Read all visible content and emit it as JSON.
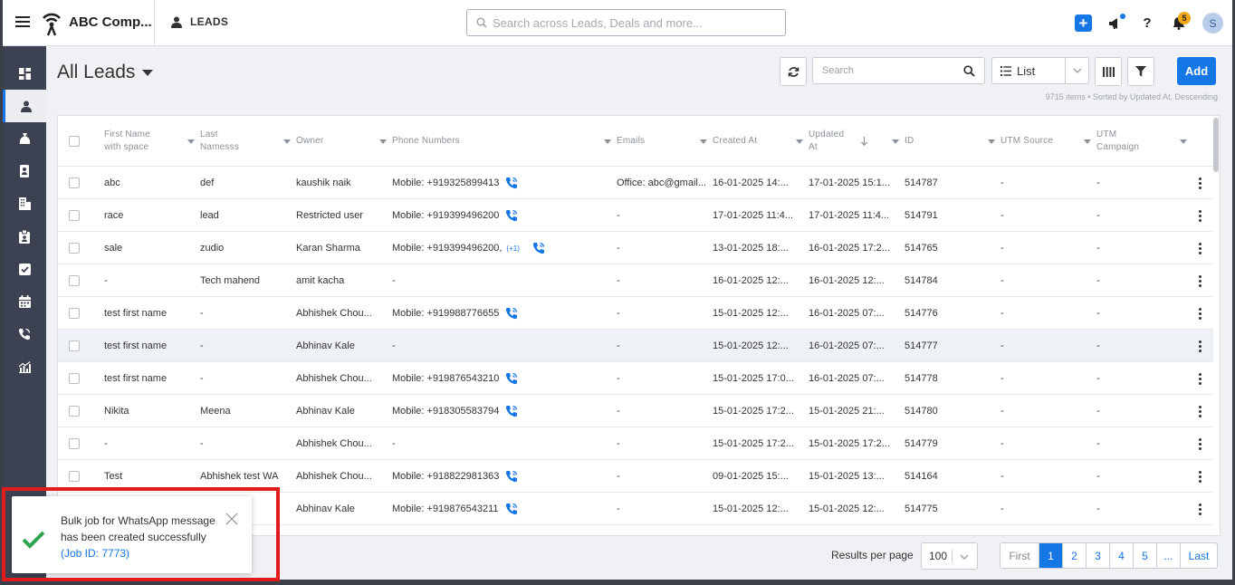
{
  "header": {
    "brand": "ABC Comp...",
    "module": "LEADS",
    "search_placeholder": "Search across Leads, Deals and more...",
    "notif_count": "5",
    "help": "?",
    "avatar": "S"
  },
  "sidebar": {
    "items": [
      {
        "icon": "dashboard-icon"
      },
      {
        "icon": "person-icon",
        "active": true
      },
      {
        "icon": "money-bag-icon"
      },
      {
        "icon": "contact-card-icon"
      },
      {
        "icon": "building-icon"
      },
      {
        "icon": "clipboard-icon"
      },
      {
        "icon": "checkbox-icon"
      },
      {
        "icon": "calendar-icon"
      },
      {
        "icon": "phone-icon"
      },
      {
        "icon": "analytics-icon"
      }
    ]
  },
  "toolbar": {
    "title": "All Leads",
    "search_placeholder": "Search",
    "view_label": "List",
    "add_label": "Add",
    "items_info": "9715 items • Sorted by Updated At, Descending"
  },
  "table": {
    "columns": [
      {
        "l1": "First Name",
        "l2": "with space"
      },
      {
        "l1": "Last",
        "l2": "Namesss"
      },
      {
        "l1": "Owner",
        "l2": ""
      },
      {
        "l1": "Phone Numbers",
        "l2": ""
      },
      {
        "l1": "Emails",
        "l2": ""
      },
      {
        "l1": "Created At",
        "l2": ""
      },
      {
        "l1": "Updated",
        "l2": "At"
      },
      {
        "l1": "ID",
        "l2": ""
      },
      {
        "l1": "UTM Source",
        "l2": ""
      },
      {
        "l1": "UTM",
        "l2": "Campaign"
      }
    ],
    "rows": [
      {
        "first": "abc",
        "last": "def",
        "owner": "kaushik naik",
        "phone": "Mobile: +919325899413",
        "phone_icon": true,
        "extra": "",
        "email": "Office: abc@gmail...",
        "created": "16-01-2025 14:...",
        "updated": "17-01-2025 15:1...",
        "id": "514787",
        "utm_source": "-",
        "utm_campaign": "-"
      },
      {
        "first": "race",
        "last": "lead",
        "owner": "Restricted user",
        "phone": "Mobile: +919399496200",
        "phone_icon": true,
        "extra": "",
        "email": "-",
        "created": "17-01-2025 11:4...",
        "updated": "17-01-2025 11:4...",
        "id": "514791",
        "utm_source": "-",
        "utm_campaign": "-"
      },
      {
        "first": "sale",
        "last": "zudio",
        "owner": "Karan Sharma",
        "phone": "Mobile: +919399496200,",
        "phone_icon": true,
        "extra": "(+1)",
        "email": "-",
        "created": "13-01-2025 18:...",
        "updated": "16-01-2025 17:2...",
        "id": "514765",
        "utm_source": "-",
        "utm_campaign": "-"
      },
      {
        "first": "-",
        "last": "Tech mahend",
        "owner": "amit kacha",
        "phone": "-",
        "phone_icon": false,
        "extra": "",
        "email": "-",
        "created": "16-01-2025 12:...",
        "updated": "16-01-2025 12:...",
        "id": "514784",
        "utm_source": "-",
        "utm_campaign": "-"
      },
      {
        "first": "test first name",
        "last": "-",
        "owner": "Abhishek Chou...",
        "phone": "Mobile: +919988776655",
        "phone_icon": true,
        "extra": "",
        "email": "-",
        "created": "15-01-2025 12:...",
        "updated": "16-01-2025 07:...",
        "id": "514776",
        "utm_source": "-",
        "utm_campaign": "-"
      },
      {
        "first": "test first name",
        "last": "-",
        "owner": "Abhinav Kale",
        "phone": "-",
        "phone_icon": false,
        "extra": "",
        "email": "-",
        "created": "15-01-2025 12:...",
        "updated": "16-01-2025 07:...",
        "id": "514777",
        "utm_source": "-",
        "utm_campaign": "-",
        "highlight": true
      },
      {
        "first": "test first name",
        "last": "-",
        "owner": "Abhishek Chou...",
        "phone": "Mobile: +919876543210",
        "phone_icon": true,
        "extra": "",
        "email": "-",
        "created": "15-01-2025 17:0...",
        "updated": "16-01-2025 07:...",
        "id": "514778",
        "utm_source": "-",
        "utm_campaign": "-"
      },
      {
        "first": "Nikita",
        "last": "Meena",
        "owner": "Abhinav Kale",
        "phone": "Mobile: +918305583794",
        "phone_icon": true,
        "extra": "",
        "email": "-",
        "created": "15-01-2025 17:2...",
        "updated": "15-01-2025 21:...",
        "id": "514780",
        "utm_source": "-",
        "utm_campaign": "-"
      },
      {
        "first": "-",
        "last": "-",
        "owner": "Abhishek Chou...",
        "phone": "-",
        "phone_icon": false,
        "extra": "",
        "email": "-",
        "created": "15-01-2025 17:2...",
        "updated": "15-01-2025 17:2...",
        "id": "514779",
        "utm_source": "-",
        "utm_campaign": "-"
      },
      {
        "first": "Test",
        "last": "Abhishek test WA",
        "owner": "Abhishek Chou...",
        "phone": "Mobile: +918822981363",
        "phone_icon": true,
        "extra": "",
        "email": "-",
        "created": "09-01-2025 15:...",
        "updated": "15-01-2025 13:...",
        "id": "514164",
        "utm_source": "-",
        "utm_campaign": "-"
      },
      {
        "first": "",
        "last": "",
        "owner": "Abhinav Kale",
        "phone": "Mobile: +919876543211",
        "phone_icon": true,
        "extra": "",
        "email": "-",
        "created": "15-01-2025 12:...",
        "updated": "15-01-2025 12:...",
        "id": "514775",
        "utm_source": "-",
        "utm_campaign": "-"
      }
    ]
  },
  "footer": {
    "rpp_label": "Results per page",
    "rpp_value": "100",
    "pager": {
      "first": "First",
      "pages": [
        "1",
        "2",
        "3",
        "4",
        "5"
      ],
      "ellipsis": "...",
      "last": "Last",
      "active": "1"
    }
  },
  "toast": {
    "line1": "Bulk job for WhatsApp message",
    "line2": "has been created successfully",
    "job": "(Job ID: 7773)"
  },
  "colors": {
    "accent": "#1576e6",
    "sidebar": "#3c4251",
    "highlight_box": "#e01b1b",
    "success": "#2ea44f"
  }
}
